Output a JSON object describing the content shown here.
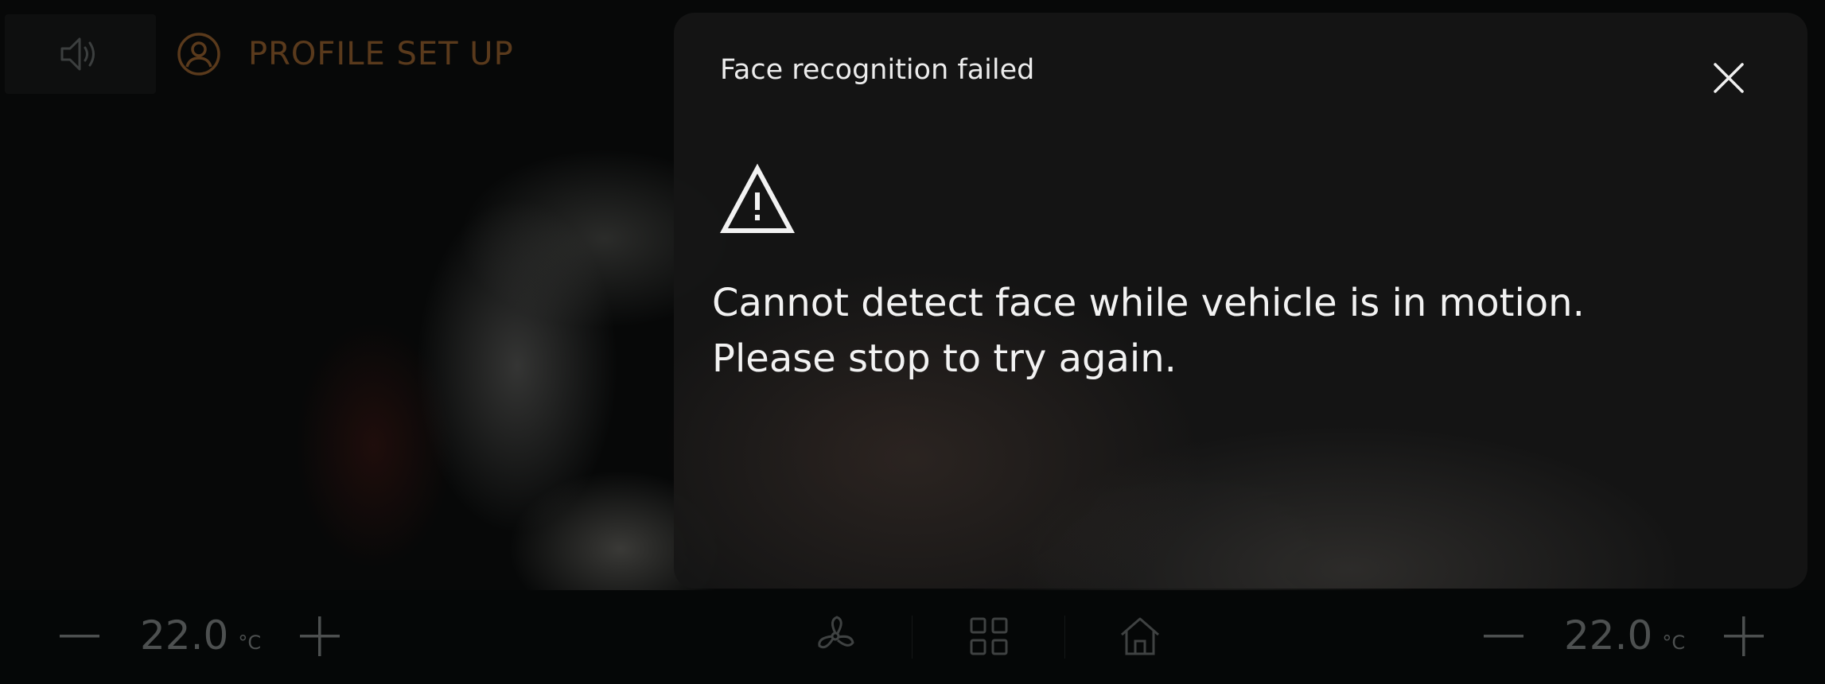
{
  "header": {
    "title": "PROFILE SET UP",
    "volume_icon": "speaker-volume-icon",
    "profile_icon": "user-profile-icon"
  },
  "dialog": {
    "title": "Face recognition failed",
    "close_icon": "close-icon",
    "warning_icon": "warning-triangle-icon",
    "message_line1": "Cannot detect face while vehicle is in motion.",
    "message_line2": "Please stop to try again."
  },
  "climate": {
    "driver": {
      "temperature": "22.0",
      "unit": "°C",
      "decrease_icon": "minus-icon",
      "increase_icon": "plus-icon"
    },
    "passenger": {
      "temperature": "22.0",
      "unit": "°C",
      "decrease_icon": "minus-icon",
      "increase_icon": "plus-icon"
    },
    "center_icons": [
      "fan-icon",
      "apps-grid-icon",
      "home-icon"
    ]
  },
  "colors": {
    "accent": "#5a3a1c",
    "dialog_text": "#f2f2f2",
    "inactive_icon": "#4d5050"
  }
}
